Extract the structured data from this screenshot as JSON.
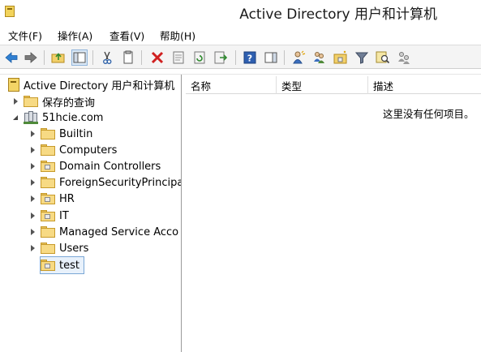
{
  "window": {
    "title": "Active Directory 用户和计算机"
  },
  "menu": [
    {
      "label": "文件(F)"
    },
    {
      "label": "操作(A)"
    },
    {
      "label": "查看(V)"
    },
    {
      "label": "帮助(H)"
    }
  ],
  "toolbar": {
    "buttons": [
      {
        "name": "back-icon"
      },
      {
        "name": "forward-icon"
      },
      {
        "name": "up-folder-icon"
      },
      {
        "name": "show-console-tree-icon"
      },
      {
        "name": "cut-icon"
      },
      {
        "name": "copy-icon"
      },
      {
        "name": "delete-icon"
      },
      {
        "name": "properties-icon"
      },
      {
        "name": "refresh-icon"
      },
      {
        "name": "export-list-icon"
      },
      {
        "name": "help-icon"
      },
      {
        "name": "show-action-pane-icon"
      },
      {
        "name": "new-user-icon"
      },
      {
        "name": "new-group-icon"
      },
      {
        "name": "new-ou-icon"
      },
      {
        "name": "filter-icon"
      },
      {
        "name": "find-icon"
      },
      {
        "name": "add-to-group-icon"
      }
    ]
  },
  "tree": {
    "root": {
      "label": "Active Directory 用户和计算机"
    },
    "saved_queries": {
      "label": "保存的查询"
    },
    "domain": {
      "label": "51hcie.com"
    },
    "children": [
      {
        "label": "Builtin",
        "type": "container"
      },
      {
        "label": "Computers",
        "type": "container"
      },
      {
        "label": "Domain Controllers",
        "type": "ou"
      },
      {
        "label": "ForeignSecurityPrincipa",
        "type": "container"
      },
      {
        "label": "HR",
        "type": "ou"
      },
      {
        "label": "IT",
        "type": "ou"
      },
      {
        "label": "Managed Service Acco",
        "type": "container"
      },
      {
        "label": "Users",
        "type": "container"
      },
      {
        "label": "test",
        "type": "ou",
        "selected": true
      }
    ]
  },
  "list": {
    "columns": [
      {
        "label": "名称"
      },
      {
        "label": "类型"
      },
      {
        "label": "描述"
      }
    ],
    "empty_message": "这里没有任何项目。"
  },
  "colors": {
    "folder": "#f7da84",
    "selection": "#e8f1fb",
    "selection_border": "#7aa7d6"
  }
}
